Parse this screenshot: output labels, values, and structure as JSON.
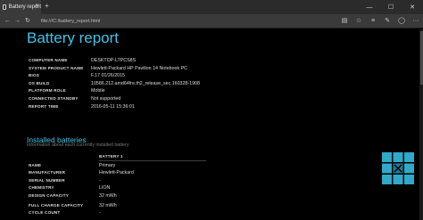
{
  "browser": {
    "tab_title": "Battery report",
    "url": "file:///C:/battery_report.html",
    "window_controls": [
      "minimize",
      "maximize",
      "close"
    ]
  },
  "report": {
    "title": "Battery report",
    "system_info": [
      {
        "label": "COMPUTER NAME",
        "value": "DESKTOP-LTPCS8S"
      },
      {
        "label": "SYSTEM PRODUCT NAME",
        "value": "Hewlett-Packard HP Pavilion 14 Notebook PC"
      },
      {
        "label": "BIOS",
        "value": "F.17 01/26/2015"
      },
      {
        "label": "OS BUILD",
        "value": "10586.212.amd64fre.th2_release_sec.160328-1908"
      },
      {
        "label": "PLATFORM ROLE",
        "value": "Mobile"
      },
      {
        "label": "CONNECTED STANDBY",
        "value": "Not supported"
      },
      {
        "label": "REPORT TIME",
        "value": "2016-05-11   15:36:01"
      }
    ],
    "installed_batteries": {
      "title": "Installed batteries",
      "subtitle": "Information about each currently installed battery",
      "column_header": "BATTERY 1",
      "rows": [
        {
          "label": "NAME",
          "value": "Primary"
        },
        {
          "label": "MANUFACTURER",
          "value": "Hewlett-Packard"
        },
        {
          "label": "SERIAL NUMBER",
          "value": "-"
        },
        {
          "label": "CHEMISTRY",
          "value": "LION"
        },
        {
          "label": "DESIGN CAPACITY",
          "value": "32 mWh"
        },
        {
          "label": "FULL CHARGE CAPACITY",
          "value": "32 mWh"
        },
        {
          "label": "CYCLE COUNT",
          "value": "-"
        }
      ]
    }
  },
  "colors": {
    "accent": "#41c4e8",
    "background": "#000000",
    "text": "#dcdcdc",
    "logo": "#2ea9c9"
  }
}
